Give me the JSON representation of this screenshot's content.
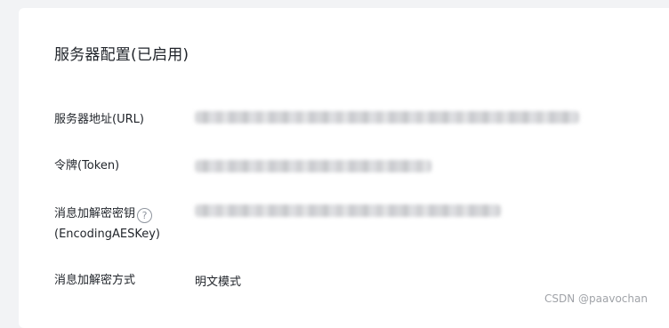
{
  "section": {
    "title": "服务器配置(已启用)"
  },
  "fields": {
    "server_url": {
      "label": "服务器地址(URL)",
      "value_hidden": true
    },
    "token": {
      "label": "令牌(Token)",
      "value_hidden": true
    },
    "aes_key": {
      "label_line1": "消息加解密密钥",
      "label_line2": "(EncodingAESKey)",
      "help_icon": "question-circle-icon",
      "help_glyph": "?",
      "value_hidden": true
    },
    "encryption_mode": {
      "label": "消息加解密方式",
      "value": "明文模式"
    }
  },
  "watermark": "CSDN @paavochan"
}
